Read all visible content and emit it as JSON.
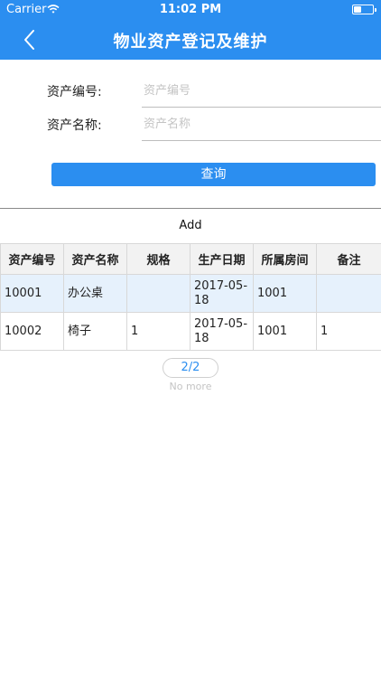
{
  "status_bar": {
    "carrier": "Carrier",
    "time": "11:02 PM",
    "battery_level": 0.4
  },
  "nav": {
    "title": "物业资产登记及维护",
    "back_icon": "chevron-left-icon"
  },
  "form": {
    "asset_no": {
      "label": "资产编号:",
      "placeholder": "资产编号",
      "value": ""
    },
    "asset_name": {
      "label": "资产名称:",
      "placeholder": "资产名称",
      "value": ""
    }
  },
  "query_button": "查询",
  "add_label": "Add",
  "table": {
    "headers": [
      "资产编号",
      "资产名称",
      "规格",
      "生产日期",
      "所属房间",
      "备注"
    ],
    "rows": [
      [
        "10001",
        "办公桌",
        "",
        "2017-05-18",
        "1001",
        ""
      ],
      [
        "10002",
        "椅子",
        "1",
        "2017-05-18",
        "1001",
        "1"
      ]
    ]
  },
  "pager": {
    "label": "2/2",
    "footer": "No more"
  },
  "colors": {
    "accent": "#2b8ef0",
    "selected_row": "#e6f1fc"
  }
}
